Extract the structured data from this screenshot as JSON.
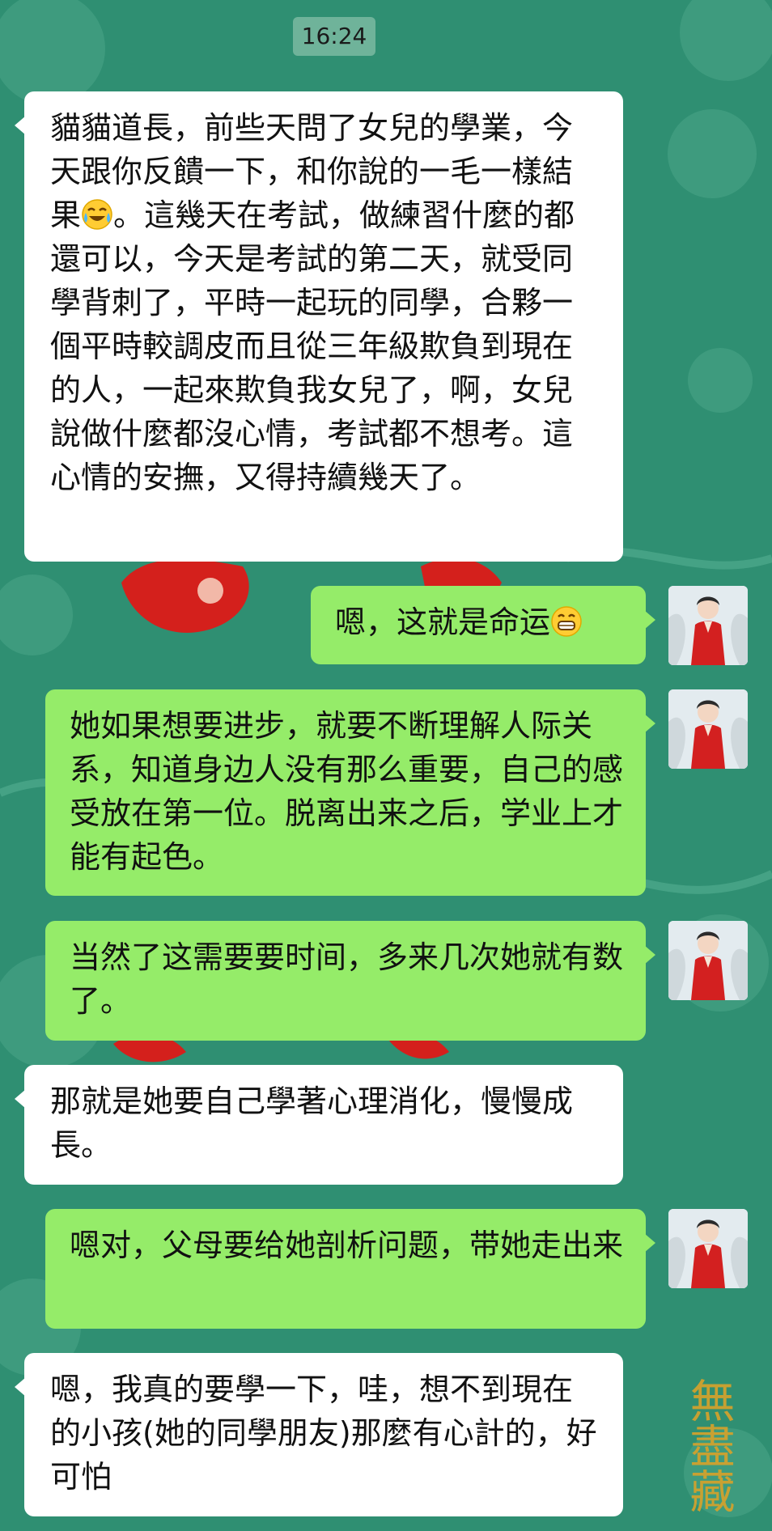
{
  "chat": {
    "timestamp": "16:24",
    "messages": [
      {
        "side": "incoming",
        "text_before": "貓貓道長，前些天問了女兒的學業，今天跟你反饋一下，和你說的一毛一樣結果",
        "emoji": "laughing-crying-emoji",
        "text_after": "。這幾天在考試，做練習什麼的都還可以，今天是考試的第二天，就受同學背刺了，平時一起玩的同學，合夥一個平時較調皮而且從三年級欺負到現在的人，一起來欺負我女兒了，啊，女兒說做什麼都沒心情，考試都不想考。這心情的安撫，又得持續幾天了。"
      },
      {
        "side": "outgoing",
        "text": "嗯，这就是命运",
        "emoji": "grinning-emoji"
      },
      {
        "side": "outgoing",
        "text": "她如果想要进步，就要不断理解人际关系，知道身边人没有那么重要，自己的感受放在第一位。脱离出来之后，学业上才能有起色。"
      },
      {
        "side": "outgoing",
        "text": "当然了这需要要时间，多来几次她就有数了。"
      },
      {
        "side": "incoming",
        "text": "那就是她要自己學著心理消化，慢慢成長。"
      },
      {
        "side": "outgoing",
        "text": "嗯对，父母要给她剖析问题，带她走出来"
      },
      {
        "side": "incoming",
        "text": "嗯，我真的要學一下，哇，想不到現在的小孩(她的同學朋友)那麼有心計的，好可怕"
      }
    ]
  },
  "background": {
    "seal_text": "無盡藏"
  },
  "colors": {
    "background": "#2f8f72",
    "incoming_bubble": "#ffffff",
    "outgoing_bubble": "#95ec69",
    "timestamp_pill": "#6fb39a",
    "decoration_red": "#d4201c",
    "seal_gold": "#d8a22a"
  }
}
